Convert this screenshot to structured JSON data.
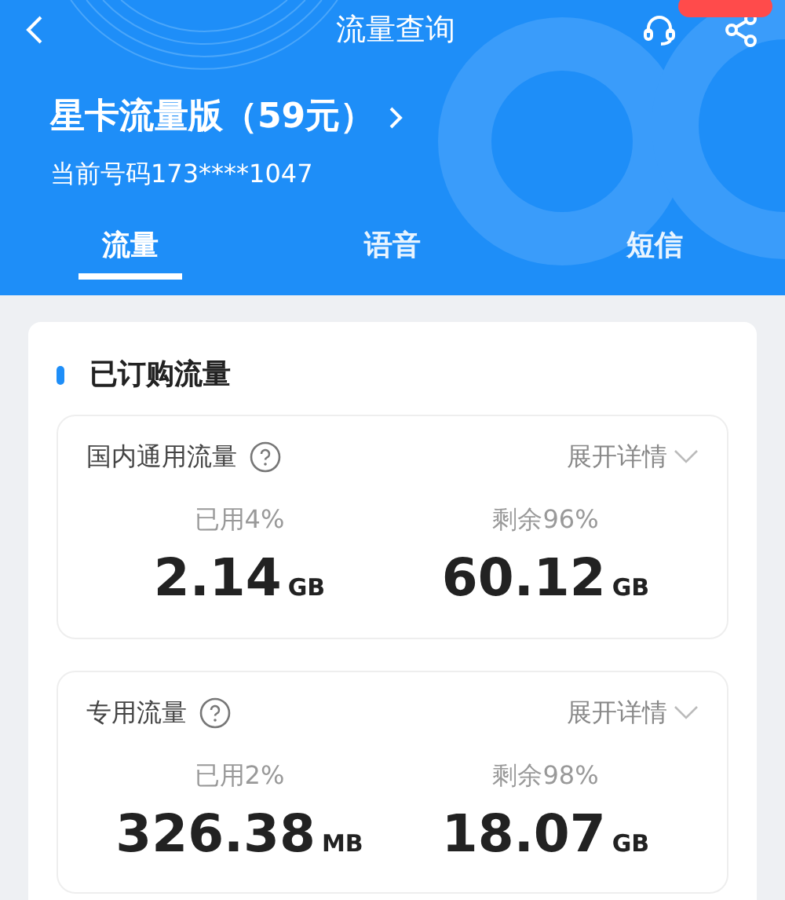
{
  "header": {
    "title": "流量查询",
    "plan": "星卡流量版（59元）",
    "phone": "当前号码173****1047"
  },
  "tabs": [
    {
      "label": "流量",
      "selected": true
    },
    {
      "label": "语音",
      "selected": false
    },
    {
      "label": "短信",
      "selected": false
    }
  ],
  "section": {
    "title": "已订购流量",
    "packages": [
      {
        "name": "国内通用流量",
        "details": "展开详情",
        "expanded": false,
        "used_label": "已用4%",
        "used_value": "2.14",
        "used_unit": "GB",
        "left_label": "剩余96%",
        "left_value": "60.12",
        "left_unit": "GB"
      },
      {
        "name": "专用流量",
        "details": "展开详情",
        "expanded": false,
        "used_label": "已用2%",
        "used_value": "326.38",
        "used_unit": "MB",
        "left_label": "剩余98%",
        "left_value": "18.07",
        "left_unit": "GB"
      }
    ]
  }
}
